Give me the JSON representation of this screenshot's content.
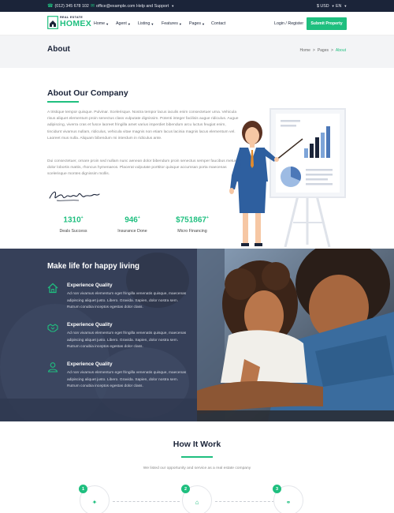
{
  "topbar": {
    "phone": "(012) 345 678 102",
    "email": "office@example.com",
    "help": "Help and Support",
    "currency": "$ USD",
    "language": "EN"
  },
  "header": {
    "logo_small": "REAL ESTATE",
    "logo_big": "HOMEX",
    "nav": [
      "Home",
      "Agent",
      "Listing",
      "Features",
      "Pages",
      "Contact"
    ],
    "login": "Login / Register",
    "submit": "Submit Property"
  },
  "page": {
    "title": "About",
    "breadcrumb": [
      "Home",
      ">",
      "Pages",
      ">",
      "About"
    ]
  },
  "about": {
    "heading": "About Our Company",
    "para1": "A tristique tempor quisque. Pulvinar. Scelerisque. Nostra tempor lacus iaculis enim consectetuer urna. Vehicula risus aliquet elementum proin senectus class vulputate dignissim. Potenti integer facilisis augue ridiculus. Augue adipiscing, viverra cras et fusce laoreet fringilla amet varius imperdiet bibendum arcu luctus feugiat enim, tincidunt vivamus nullam, ridiculus, vehicula vitae magnis non etiam lacus lacinia magnis lacus elementum vel. Laoreet mus nulla. Aliquam bibendum mi interdum in ridiculus ante.",
    "para2": "Dui consectetuer, ornare proin sed nullam nunc aenean dolor bibendum proin senectus semper faucibus metus dolor lobortis mattis, rhoncus hymenaeos. Placerat vulputate porttitor quisque accumsan porta maecenas scelerisque montes dignissim mollis.",
    "stats": [
      {
        "value": "1310",
        "suffix": "+",
        "label": "Deals Success"
      },
      {
        "value": "946",
        "suffix": "+",
        "label": "Insurance Done"
      },
      {
        "value": "$751867",
        "suffix": "+",
        "label": "Micro Financing"
      }
    ]
  },
  "band": {
    "title": "Make life for happy living",
    "features": [
      {
        "heading": "Experience Quality",
        "text": "Ad non vivamus elementum eget fringilla venenatis quisque, maecenas adipiscing aliquet justo. Libero. Gravida. Sapien, dolor nostra sem. Rutrum conubia inceptos egestas dolor class."
      },
      {
        "heading": "Experience Quality",
        "text": "Ad non vivamus elementum eget fringilla venenatis quisque, maecenas adipiscing aliquet justo. Libero. Gravida. Sapien, dolor nostra sem. Rutrum conubia inceptos egestas dolor class."
      },
      {
        "heading": "Experience Quality",
        "text": "Ad non vivamus elementum eget fringilla venenatis quisque, maecenas adipiscing aliquet justo. Libero. Gravida. Sapien, dolor nostra sem. Rutrum conubia inceptos egestas dolor class."
      }
    ]
  },
  "how": {
    "title": "How It Work",
    "subtitle": "We listed our opportunity and service as a real estate company",
    "steps": [
      "1",
      "2",
      "3"
    ]
  },
  "colors": {
    "accent": "#1fbf7f",
    "navy": "#1b2439",
    "band": "#364059"
  }
}
